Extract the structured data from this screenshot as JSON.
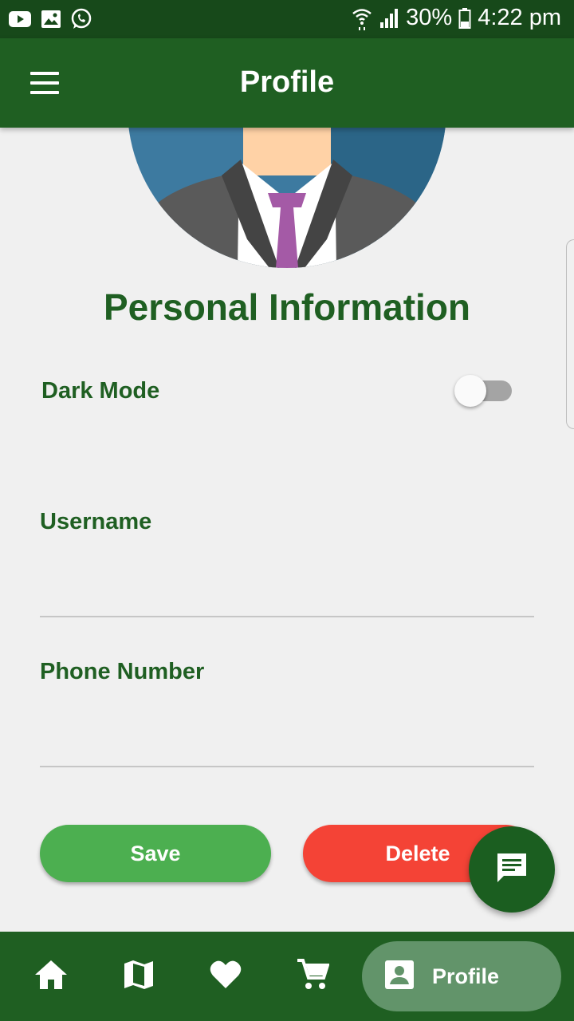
{
  "status_bar": {
    "battery": "30%",
    "time": "4:22 pm",
    "left_icons": [
      "youtube-icon",
      "gallery-icon",
      "whatsapp-icon"
    ],
    "right_icons": [
      "wifi-icon",
      "signal-icon",
      "battery-icon"
    ]
  },
  "app_bar": {
    "title": "Profile",
    "menu_icon": "menu-icon"
  },
  "profile": {
    "section_title": "Personal Information",
    "dark_mode_label": "Dark Mode",
    "dark_mode_on": false,
    "username_label": "Username",
    "username_value": "",
    "phone_label": "Phone Number",
    "phone_value": ""
  },
  "actions": {
    "save": "Save",
    "delete": "Delete",
    "fab_icon": "chat-icon"
  },
  "bottom_nav": {
    "items": [
      {
        "icon": "home-icon"
      },
      {
        "icon": "map-icon"
      },
      {
        "icon": "heart-icon"
      },
      {
        "icon": "cart-icon"
      }
    ],
    "active": {
      "icon": "account-box-icon",
      "label": "Profile"
    }
  },
  "colors": {
    "status_bar": "#17491a",
    "primary": "#1f5f22",
    "save": "#4caf50",
    "delete": "#f44336",
    "nav_active": "#62946a",
    "background": "#f0f0f0"
  }
}
